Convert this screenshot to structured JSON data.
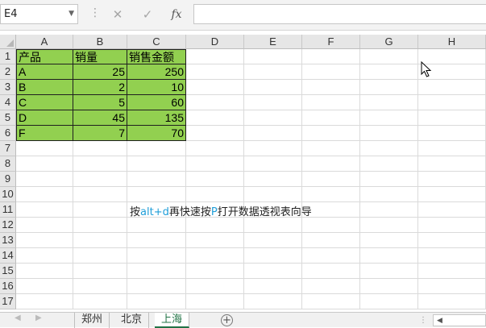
{
  "formula_bar": {
    "name_box": "E4",
    "cancel_icon": "✕",
    "enter_icon": "✓",
    "fx_label": "fx",
    "formula_value": ""
  },
  "columns": [
    "A",
    "B",
    "C",
    "D",
    "E",
    "F",
    "G",
    "H"
  ],
  "rows": [
    "1",
    "2",
    "3",
    "4",
    "5",
    "6",
    "7",
    "8",
    "9",
    "10",
    "11",
    "12",
    "13",
    "14",
    "15",
    "16",
    "17"
  ],
  "table": {
    "headers": [
      "产品",
      "销量",
      "销售金额"
    ],
    "rows": [
      [
        "A",
        "25",
        "250"
      ],
      [
        "B",
        "2",
        "10"
      ],
      [
        "C",
        "5",
        "60"
      ],
      [
        "D",
        "45",
        "135"
      ],
      [
        "F",
        "7",
        "70"
      ]
    ]
  },
  "note": {
    "p1": "按",
    "p2": "alt+d",
    "p3": "再快速按",
    "p4": "P",
    "p5": "打开数据透视表向导"
  },
  "sheet_tabs": {
    "add_label": "+",
    "tabs": [
      "郑州",
      "北京",
      "上海"
    ],
    "active": "上海"
  },
  "colors": {
    "table_fill": "#92d050",
    "highlight_text": "#1f9ed8",
    "active_tab": "#217346"
  }
}
